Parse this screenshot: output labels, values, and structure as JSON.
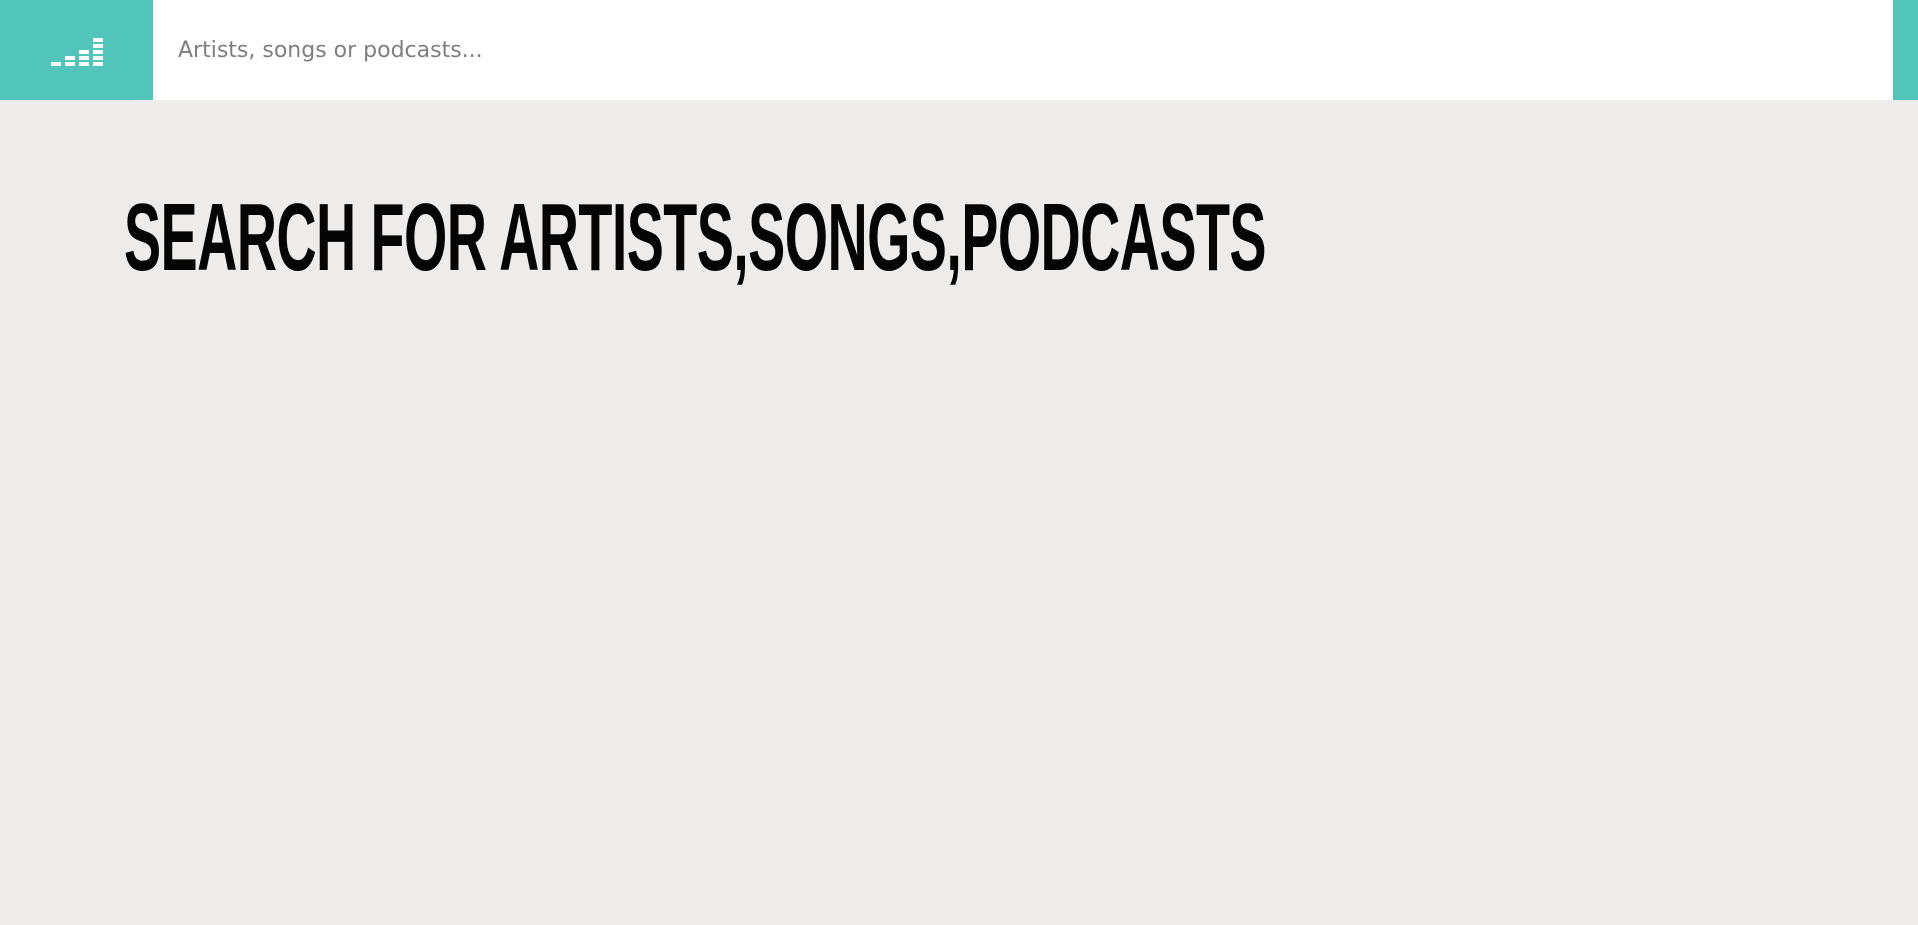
{
  "header": {
    "logo_icon": "equalizer-logo-icon",
    "accent_color": "#52c5bb",
    "search": {
      "value": "",
      "placeholder": "Artists, songs or podcasts..."
    }
  },
  "main": {
    "title": "SEARCH FOR ARTISTS,SONGS,PODCASTS",
    "background_color": "#edeceb"
  }
}
